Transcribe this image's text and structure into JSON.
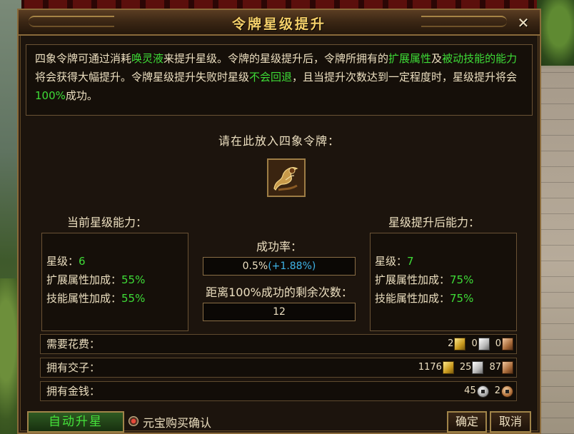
{
  "dialog": {
    "title": "令牌星级提升",
    "close_label": "✕"
  },
  "description": {
    "s1": "四象令牌可通过消耗",
    "h1": "唤灵液",
    "s2": "来提升星级。令牌的星级提升后，令牌所拥有的",
    "h2": "扩展属性",
    "s3": "及",
    "h3": "被动技能的能力",
    "s4": "将会获得大幅提升。令牌星级提升失败时星级",
    "h4": "不会回退",
    "s5": "，且当提升次数达到一定程度时，星级提升将会",
    "h5": "100%",
    "s6": "成功。"
  },
  "slot": {
    "label": "请在此放入四象令牌：",
    "icon": "token-item-icon"
  },
  "current": {
    "title": "当前星级能力：",
    "star_label": "星级：",
    "star_value": "6",
    "ext_label": "扩展属性加成：",
    "ext_value": "55%",
    "skill_label": "技能属性加成：",
    "skill_value": "55%"
  },
  "after": {
    "title": "星级提升后能力：",
    "star_label": "星级：",
    "star_value": "7",
    "ext_label": "扩展属性加成：",
    "ext_value": "75%",
    "skill_label": "技能属性加成：",
    "skill_value": "75%"
  },
  "rate": {
    "label": "成功率：",
    "value": "0.5%",
    "bonus": "(+1.88%)"
  },
  "remaining": {
    "label": "距离100%成功的剩余次数：",
    "value": "12"
  },
  "cost": {
    "label": "需要花费：",
    "gold": "2",
    "silver": "0",
    "copper": "0"
  },
  "owned_notes": {
    "label": "拥有交子：",
    "gold": "1176",
    "silver": "25",
    "copper": "87"
  },
  "owned_money": {
    "label": "拥有金钱：",
    "silver": "45",
    "copper": "2"
  },
  "bottom": {
    "auto_label": "自动升星",
    "confirm_label": "元宝购买确认",
    "ok_label": "确定",
    "cancel_label": "取消"
  },
  "colors": {
    "highlight": "#3edc37",
    "bonus": "#3fb4e8",
    "title": "#f4cf6a"
  }
}
